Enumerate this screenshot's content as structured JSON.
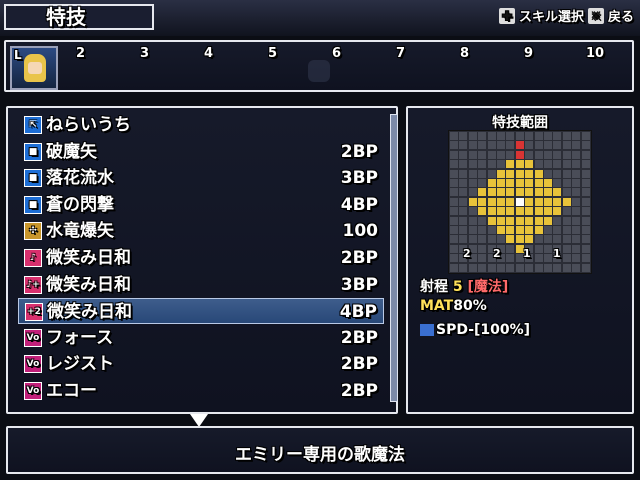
{
  "header": {
    "title": "特技",
    "help_skill": "スキル選択",
    "help_back": "戻る"
  },
  "slots": {
    "numbers": [
      "2",
      "3",
      "4",
      "5",
      "6",
      "7",
      "8",
      "9",
      "10"
    ],
    "avatar_label": "L"
  },
  "skills": [
    {
      "name": "ねらいうち",
      "cost": "",
      "icon": "target-icon",
      "icon_text": "⇱",
      "color": "blue"
    },
    {
      "name": "破魔矢",
      "cost": "2BP",
      "icon": "skill-square-icon",
      "icon_text": "■",
      "color": "blue"
    },
    {
      "name": "落花流水",
      "cost": "3BP",
      "icon": "skill-square-icon",
      "icon_text": "■",
      "color": "blue"
    },
    {
      "name": "蒼の閃撃",
      "cost": "4BP",
      "icon": "skill-square-icon",
      "icon_text": "■",
      "color": "blue"
    },
    {
      "name": "水竜爆矢",
      "cost": "100",
      "icon": "gold-skill-icon",
      "icon_text": "✣",
      "color": "gold"
    },
    {
      "name": "微笑み日和",
      "cost": "2BP",
      "icon": "music-note-icon",
      "icon_text": "♪",
      "color": "pink"
    },
    {
      "name": "微笑み日和",
      "cost": "3BP",
      "icon": "music-note-plus-icon",
      "icon_text": "♪+",
      "color": "pink"
    },
    {
      "name": "微笑み日和",
      "cost": "4BP",
      "icon": "music-note-plus2-icon",
      "icon_text": "+2",
      "color": "pink"
    },
    {
      "name": "フォース",
      "cost": "2BP",
      "icon": "vo-icon",
      "icon_text": "Vo",
      "color": "mag"
    },
    {
      "name": "レジスト",
      "cost": "2BP",
      "icon": "vo-icon",
      "icon_text": "Vo",
      "color": "mag"
    },
    {
      "name": "エコー",
      "cost": "2BP",
      "icon": "vo-icon",
      "icon_text": "Vo",
      "color": "mag"
    }
  ],
  "selected_index": 7,
  "range_panel": {
    "title": "特技範囲",
    "range_label": "射程",
    "range_value": "5",
    "range_type": "[魔法]",
    "mat_label": "MAT",
    "mat_value": "80%",
    "spd_text": "SPD-[100%]",
    "height_markers": [
      "2",
      "2",
      "1",
      "1"
    ]
  },
  "description": "エミリー専用の歌魔法",
  "colors": {
    "blue": "#1d6ed6",
    "gold": "#c9962b",
    "pink": "#d8306e",
    "mag": "#c2207a",
    "area": "#e8c33a",
    "origin": "#d93434",
    "range_type": "#ff6a6a",
    "range_value": "#ffe15a",
    "mat": "#ffe15a"
  }
}
